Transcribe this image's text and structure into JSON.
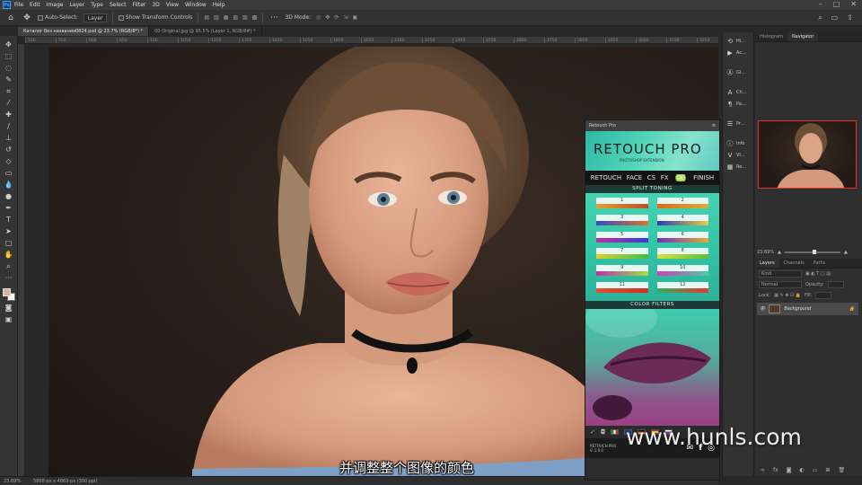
{
  "app": {
    "logo": "Ps"
  },
  "menu": [
    "File",
    "Edit",
    "Image",
    "Layer",
    "Type",
    "Select",
    "Filter",
    "3D",
    "View",
    "Window",
    "Help"
  ],
  "options_bar": {
    "auto_select_label": "Auto-Select:",
    "auto_select_value": "Layer",
    "transform_controls_label": "Show Transform Controls",
    "mode_3d_label": "3D Mode:"
  },
  "document_tabs": [
    {
      "label": "Каталог без названия0824.psd @ 23.7% (RGB/8*) *",
      "active": true
    },
    {
      "label": "00-Original.jpg @ 95.5% (Layer 1, RGB/8#) *",
      "active": false
    }
  ],
  "ruler_ticks": [
    "100",
    "550",
    "600",
    "650",
    "100",
    "1050",
    "1200",
    "1350",
    "1450",
    "1650",
    "1800",
    "2050",
    "2100",
    "2250",
    "2400",
    "2550",
    "2600",
    "2750",
    "2800",
    "2950",
    "3000",
    "3100",
    "3250",
    "3400",
    "3550"
  ],
  "toolbar_tools": [
    "move-tool",
    "marquee-tool",
    "lasso-tool",
    "quick-select-tool",
    "crop-tool",
    "eyedropper-tool",
    "healing-tool",
    "brush-tool",
    "clone-tool",
    "history-brush-tool",
    "eraser-tool",
    "gradient-tool",
    "blur-tool",
    "dodge-tool",
    "pen-tool",
    "type-tool",
    "path-select-tool",
    "shape-tool",
    "hand-tool",
    "zoom-tool",
    "more-tool"
  ],
  "status_bar": {
    "zoom": "23.69%",
    "doc_size": "5868 px x 4869 px (300 ppi)"
  },
  "subtitle": "并调整整个图像的颜色",
  "watermark": "www.hunls.com",
  "retouch_pro": {
    "panel_title": "Retouch Pro",
    "logo": "RETOUCH PRO",
    "logo_sub": "PHOTOSHOP EXTENSION",
    "nav": [
      "RETOUCH",
      "FACE",
      "CS",
      "FX",
      "CG",
      "FINISH"
    ],
    "active_nav": "CG",
    "split_toning_title": "SPLIT TONING",
    "split_toning": [
      {
        "n": "1",
        "c1": "#e8a030",
        "c2": "#c04a20"
      },
      {
        "n": "2",
        "c1": "#e06a20",
        "c2": "#d8b030"
      },
      {
        "n": "3",
        "c1": "#3050c0",
        "c2": "#e07030"
      },
      {
        "n": "4",
        "c1": "#2a3ab0",
        "c2": "#e8d040"
      },
      {
        "n": "5",
        "c1": "#c030a0",
        "c2": "#3040d0"
      },
      {
        "n": "6",
        "c1": "#7030c0",
        "c2": "#e0b030"
      },
      {
        "n": "7",
        "c1": "#e0d030",
        "c2": "#40c040"
      },
      {
        "n": "8",
        "c1": "#d8e040",
        "c2": "#60c030"
      },
      {
        "n": "9",
        "c1": "#c030b0",
        "c2": "#a0e040"
      },
      {
        "n": "10",
        "c1": "#d040c0",
        "c2": "#50c8a0"
      },
      {
        "n": "11",
        "c1": "#e05030",
        "c2": "#d03020"
      },
      {
        "n": "12",
        "c1": "#30b060",
        "c2": "#e03a30"
      }
    ],
    "color_filters_title": "COLOR FILTERS",
    "version_line1": "RETOUCH PRO",
    "version_line2": "V. 1.0.0"
  },
  "right_dock": [
    {
      "icon": "history-icon",
      "label": "Hi..."
    },
    {
      "icon": "actions-icon",
      "label": "Ac..."
    },
    {
      "icon": "glyphs-icon",
      "label": "Gl..."
    },
    {
      "icon": "character-icon",
      "label": "Ch..."
    },
    {
      "icon": "paragraph-icon",
      "label": "Pa..."
    },
    {
      "icon": "properties-icon",
      "label": "Pr..."
    },
    {
      "icon": "info-icon",
      "label": "Info"
    },
    {
      "icon": "vi-icon",
      "label": "VI..."
    },
    {
      "icon": "retouch-icon",
      "label": "Re..."
    }
  ],
  "navigator_tabs": [
    "Histogram",
    "Navigator"
  ],
  "navigator_zoom": "23.69%",
  "layers_tabs": [
    "Layers",
    "Channels",
    "Paths"
  ],
  "layers": {
    "filter_placeholder": "Kind",
    "blend_mode": "Normal",
    "opacity": "Opacity:",
    "fill": "Fill:",
    "lock": "Lock:",
    "items": [
      {
        "name": "Background"
      }
    ]
  }
}
